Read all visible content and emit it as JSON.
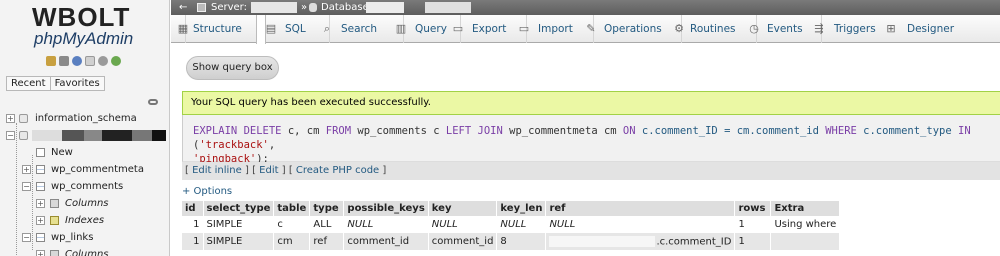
{
  "nav": {
    "logo_brand": "WBOLT",
    "logo_product": "phpMyAdmin",
    "tabs": [
      "Recent",
      "Favorites"
    ],
    "tree": {
      "information_schema": "information_schema",
      "new_label": "New",
      "tables": [
        "wp_commentmeta",
        "wp_comments",
        "wp_links"
      ],
      "columns_label": "Columns",
      "indexes_label": "Indexes"
    }
  },
  "breadcrumb": {
    "back_arrow": "←",
    "server_label": "Server:",
    "separator": "»",
    "database_label": "Database:"
  },
  "tabs": [
    {
      "label": "Structure",
      "icon": "structure-icon"
    },
    {
      "label": "SQL",
      "icon": "sql-icon"
    },
    {
      "label": "Search",
      "icon": "search-icon"
    },
    {
      "label": "Query",
      "icon": "query-icon"
    },
    {
      "label": "Export",
      "icon": "export-icon"
    },
    {
      "label": "Import",
      "icon": "import-icon"
    },
    {
      "label": "Operations",
      "icon": "operations-icon"
    },
    {
      "label": "Routines",
      "icon": "routines-icon"
    },
    {
      "label": "Events",
      "icon": "events-icon"
    },
    {
      "label": "Triggers",
      "icon": "triggers-icon"
    },
    {
      "label": "Designer",
      "icon": "designer-icon"
    }
  ],
  "main": {
    "show_query_box": "Show query box",
    "success_message": "Your SQL query has been executed successfully.",
    "sql": {
      "p1": "EXPLAIN DELETE",
      "p2": " c, cm ",
      "p3": "FROM",
      "p4": " wp_comments c ",
      "p5": "LEFT JOIN",
      "p6": " wp_commentmeta cm ",
      "p7": "ON",
      "p8": " c.comment_ID = cm.comment_id ",
      "p9": "WHERE",
      "p10": " c.comment_type ",
      "p11": "IN",
      "p12": " (",
      "p13": "'trackback'",
      "p14": ",",
      "p15": "'pingback'",
      "p16": ");"
    },
    "links": {
      "open1": "[",
      "edit_inline": "Edit inline",
      "sep1": "] [",
      "edit": "Edit",
      "sep2": "] [",
      "create_php": "Create PHP code",
      "close": "]"
    },
    "options_label": "+ Options",
    "result": {
      "headers": [
        "id",
        "select_type",
        "table",
        "type",
        "possible_keys",
        "key",
        "key_len",
        "ref",
        "rows",
        "Extra"
      ],
      "rows": [
        [
          "1",
          "SIMPLE",
          "c",
          "ALL",
          "NULL",
          "NULL",
          "NULL",
          "NULL",
          "1",
          "Using where"
        ],
        [
          "1",
          "SIMPLE",
          "cm",
          "ref",
          "comment_id",
          "comment_id",
          "8",
          ".c.comment_ID",
          "1",
          ""
        ]
      ]
    }
  },
  "colors": {
    "success_bg": "#ebf8a4",
    "success_border": "#a2d246",
    "link": "#235a81"
  }
}
